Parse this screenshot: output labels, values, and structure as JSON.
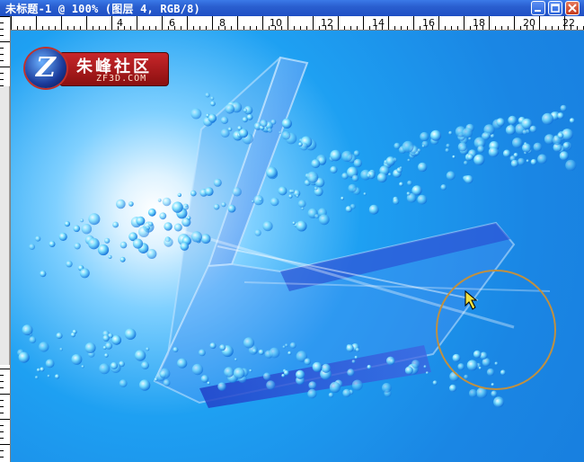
{
  "window": {
    "title": "未标题-1 @ 100% (图层 4, RGB/8)"
  },
  "ruler": {
    "top_labels": [
      "4",
      "6",
      "8",
      "10",
      "12",
      "14",
      "16",
      "18",
      "20",
      "22"
    ]
  },
  "watermark": {
    "badge_letter": "Z",
    "title": "朱峰社区",
    "subtitle": "ZF3D.COM"
  },
  "colors": {
    "titlebar": "#2a5fd0",
    "canvas_bg": "#1a86e4",
    "glow": "#ffffff",
    "brush_circle": "#c09040"
  },
  "icons": {
    "minimize": "minimize-icon",
    "maximize": "maximize-icon",
    "close": "close-icon",
    "cursor": "move-cursor-icon"
  }
}
